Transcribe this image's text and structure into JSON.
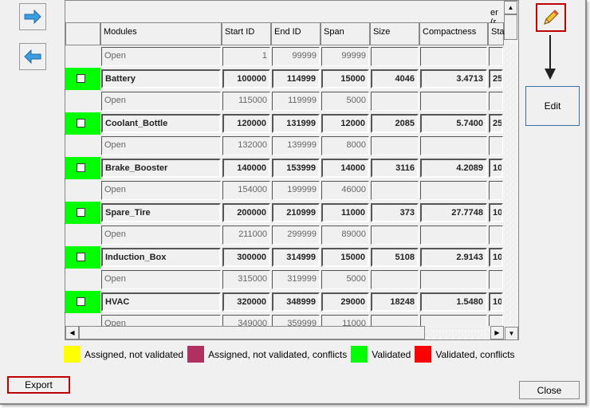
{
  "grid": {
    "top_header_partial": "er (r",
    "columns": [
      "",
      "Modules",
      "Start ID",
      "End ID",
      "Span",
      "Size",
      "Compactness",
      "Sta"
    ],
    "rows": [
      {
        "type": "open",
        "module": "Open",
        "start": "1",
        "end": "99999",
        "span": "99999",
        "size": "",
        "compactness": "",
        "status": ""
      },
      {
        "type": "module",
        "module": "Battery",
        "start": "100000",
        "end": "114999",
        "span": "15000",
        "size": "4046",
        "compactness": "3.4713",
        "status": "25",
        "color": "#00ff00"
      },
      {
        "type": "open",
        "module": "Open",
        "start": "115000",
        "end": "119999",
        "span": "5000",
        "size": "",
        "compactness": "",
        "status": ""
      },
      {
        "type": "module",
        "module": "Coolant_Bottle",
        "start": "120000",
        "end": "131999",
        "span": "12000",
        "size": "2085",
        "compactness": "5.7400",
        "status": "25",
        "color": "#00ff00"
      },
      {
        "type": "open",
        "module": "Open",
        "start": "132000",
        "end": "139999",
        "span": "8000",
        "size": "",
        "compactness": "",
        "status": ""
      },
      {
        "type": "module",
        "module": "Brake_Booster",
        "start": "140000",
        "end": "153999",
        "span": "14000",
        "size": "3116",
        "compactness": "4.2089",
        "status": "10",
        "color": "#00ff00"
      },
      {
        "type": "open",
        "module": "Open",
        "start": "154000",
        "end": "199999",
        "span": "46000",
        "size": "",
        "compactness": "",
        "status": ""
      },
      {
        "type": "module",
        "module": "Spare_Tire",
        "start": "200000",
        "end": "210999",
        "span": "11000",
        "size": "373",
        "compactness": "27.7748",
        "status": "10",
        "color": "#00ff00"
      },
      {
        "type": "open",
        "module": "Open",
        "start": "211000",
        "end": "299999",
        "span": "89000",
        "size": "",
        "compactness": "",
        "status": ""
      },
      {
        "type": "module",
        "module": "Induction_Box",
        "start": "300000",
        "end": "314999",
        "span": "15000",
        "size": "5108",
        "compactness": "2.9143",
        "status": "10",
        "color": "#00ff00"
      },
      {
        "type": "open",
        "module": "Open",
        "start": "315000",
        "end": "319999",
        "span": "5000",
        "size": "",
        "compactness": "",
        "status": ""
      },
      {
        "type": "module",
        "module": "HVAC",
        "start": "320000",
        "end": "348999",
        "span": "29000",
        "size": "18248",
        "compactness": "1.5480",
        "status": "10",
        "color": "#00ff00"
      },
      {
        "type": "open",
        "module": "Open",
        "start": "349000",
        "end": "359999",
        "span": "11000",
        "size": "",
        "compactness": "",
        "status": ""
      }
    ]
  },
  "legend": [
    {
      "label": "Assigned, not validated",
      "color": "#ffff00"
    },
    {
      "label": "Assigned, not validated, conflicts",
      "color": "#b03060"
    },
    {
      "label": "Validated",
      "color": "#00ff00"
    },
    {
      "label": "Validated, conflicts",
      "color": "#ff0000"
    }
  ],
  "buttons": {
    "edit": "Edit",
    "export": "Export",
    "close": "Close"
  },
  "icons": {
    "nav_right": "arrow-right-icon",
    "nav_left": "arrow-left-icon",
    "edit": "pencil-icon"
  }
}
